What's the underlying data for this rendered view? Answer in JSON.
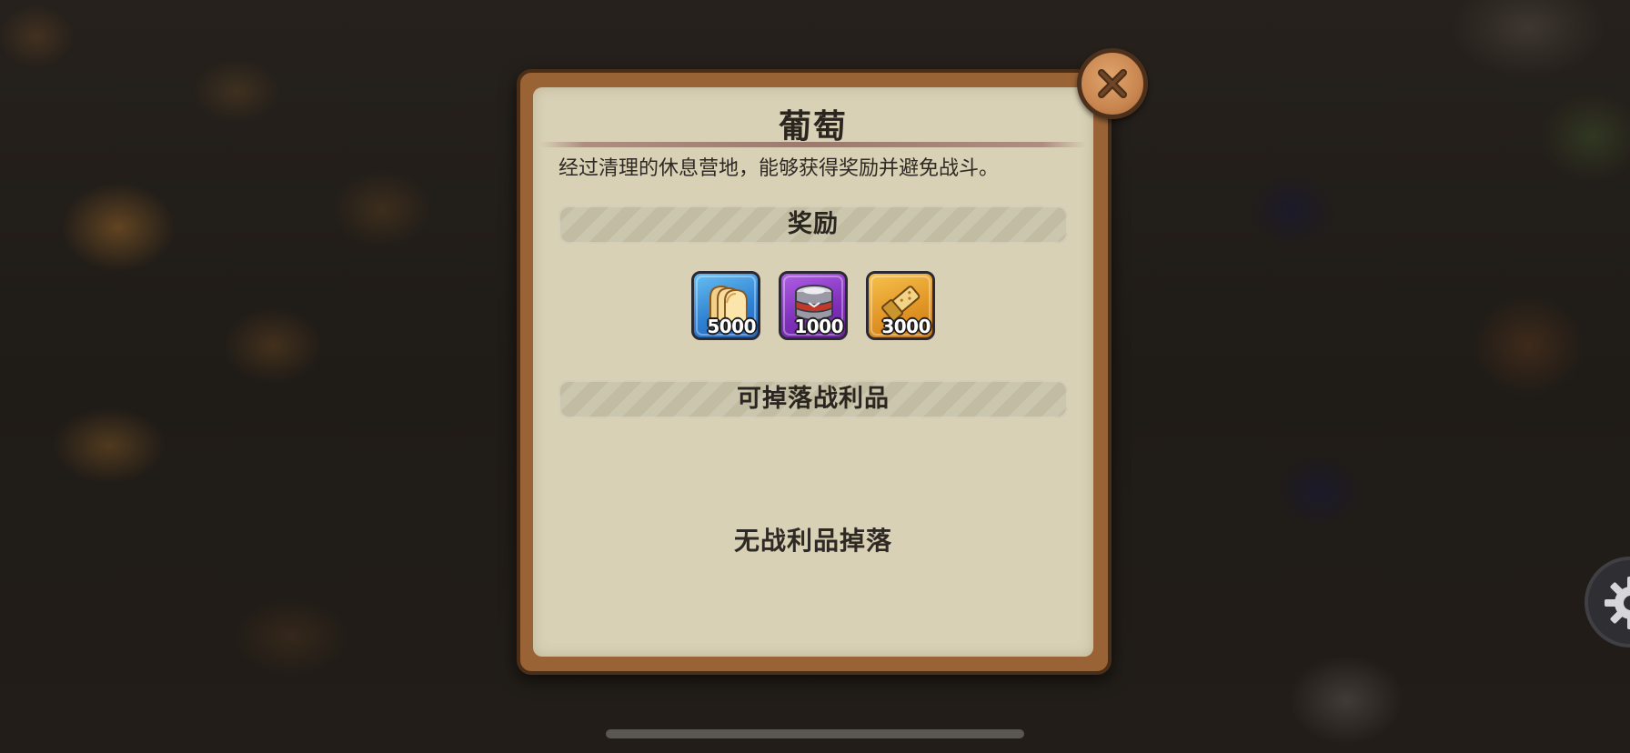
{
  "dialog": {
    "title": "葡萄",
    "description": "经过清理的休息营地，能够获得奖励并避免战斗。",
    "rewards_header": "奖励",
    "rewards": [
      {
        "icon": "bread-icon",
        "quantity": "5000",
        "rarity_color": "#2d7fd1"
      },
      {
        "icon": "canned-food-icon",
        "quantity": "1000",
        "rarity_color": "#7d2fb8"
      },
      {
        "icon": "energy-bar-icon",
        "quantity": "3000",
        "rarity_color": "#e09424"
      }
    ],
    "loot_header": "可掉落战利品",
    "no_loot_text": "无战利品掉落"
  },
  "controls": {
    "close_icon": "close-icon",
    "settings_icon": "gear-icon"
  },
  "colors": {
    "panel": "#d8d1b6",
    "frame": "#9a6336",
    "text": "#2b2520"
  }
}
